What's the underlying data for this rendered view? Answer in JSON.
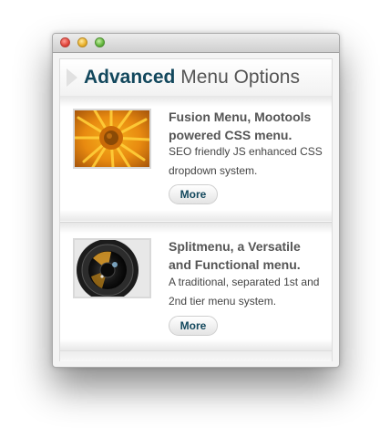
{
  "window": {
    "title_strong": "Advanced",
    "title_rest": "Menu Options"
  },
  "items": [
    {
      "title": "Fusion Menu, Mootools powered CSS menu.",
      "description": "SEO friendly JS enhanced CSS dropdown system.",
      "more_label": "More",
      "image": "orange-flower-photo"
    },
    {
      "title": "Splitmenu, a Versatile and Functional menu.",
      "description": "A traditional, separated 1st and 2nd tier menu system.",
      "more_label": "More",
      "image": "camera-lens-photo"
    }
  ],
  "colors": {
    "accent": "#13485d",
    "text": "#555555",
    "close": "#e0443a",
    "minimize": "#e9b02a",
    "zoom": "#62b53c"
  }
}
